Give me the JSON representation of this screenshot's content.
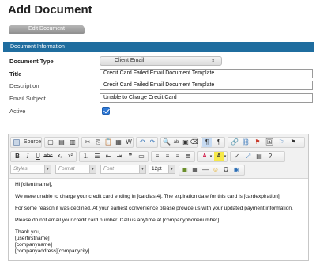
{
  "page": {
    "title": "Add Document",
    "tab_label": "Edit Document"
  },
  "section": {
    "header": "Document Information"
  },
  "form": {
    "document_type": {
      "label": "Document Type",
      "value": "Client Email"
    },
    "title": {
      "label": "Title",
      "value": "Credit Card Failed Email Document Template"
    },
    "description": {
      "label": "Description",
      "value": "Credit Card Failed Email Document Template"
    },
    "email_subject": {
      "label": "Email Subject",
      "value": "Unable to Charge Credit Card"
    },
    "active": {
      "label": "Active",
      "checked": true
    }
  },
  "toolbar": {
    "source_label": "Source",
    "styles_placeholder": "Styles",
    "format_placeholder": "Format",
    "font_placeholder": "Font",
    "size_value": "12pt"
  },
  "editor": {
    "greeting": "Hi [clientfname],",
    "para1": "We were unable to charge your credit card ending in [cardlast4].  The expiration date for this card is [cardexpiration].",
    "para2": "For some reason it was declined.  At your earliest convenience please provide us with your updated payment information.",
    "para3": "Please do not email your credit card number.  Call us anytime at [companyphonenumber].",
    "sig_thanks": "Thank you,",
    "sig_name": "[userfirstname]",
    "sig_company": "[companyname]",
    "sig_address": "[companyaddress][companycity]"
  },
  "colors": {
    "section_bar": "#1f6d9f",
    "checkbox": "#2f79d6"
  }
}
